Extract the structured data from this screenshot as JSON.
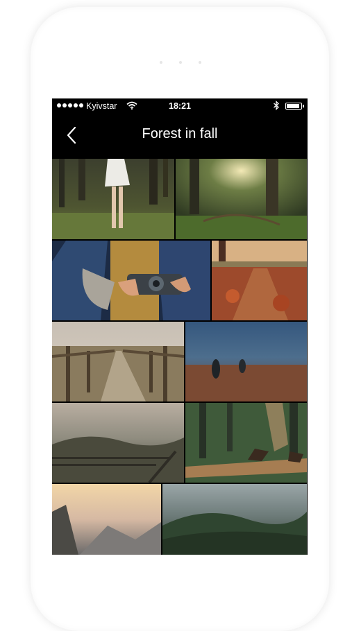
{
  "status_bar": {
    "carrier": "Kyivstar",
    "time": "18:21"
  },
  "nav": {
    "title": "Forest in fall"
  },
  "photos": [
    {
      "subject": "girl-in-white-dress-forest"
    },
    {
      "subject": "sunlit-forest-clearing"
    },
    {
      "subject": "hands-holding-camera"
    },
    {
      "subject": "autumn-leaves-path"
    },
    {
      "subject": "wooden-bridge"
    },
    {
      "subject": "foggy-field-hikers"
    },
    {
      "subject": "misty-hills-railing"
    },
    {
      "subject": "hiker-on-boardwalk"
    },
    {
      "subject": "mountain-sunset"
    },
    {
      "subject": "foggy-forest-hills"
    }
  ]
}
